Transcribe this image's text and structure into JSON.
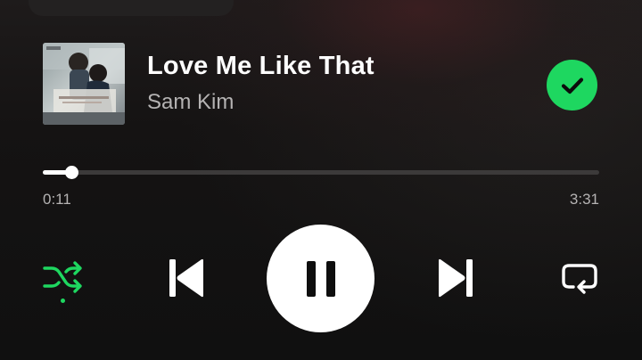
{
  "track": {
    "title": "Love Me Like That",
    "artist": "Sam Kim",
    "liked": true
  },
  "playback": {
    "elapsed": "0:11",
    "duration": "3:31",
    "progress_fraction": 0.052,
    "is_playing": true,
    "shuffle_on": true,
    "repeat_on": false
  },
  "icons": {
    "liked": "check-circle-icon",
    "shuffle": "shuffle-icon",
    "previous": "skip-previous-icon",
    "play_pause": "pause-icon",
    "next": "skip-next-icon",
    "repeat": "repeat-icon"
  },
  "colors": {
    "accent": "#1ed760",
    "primary_text": "#ffffff",
    "secondary_text": "#b5b3b3",
    "track_background": "#3c3a3a"
  }
}
